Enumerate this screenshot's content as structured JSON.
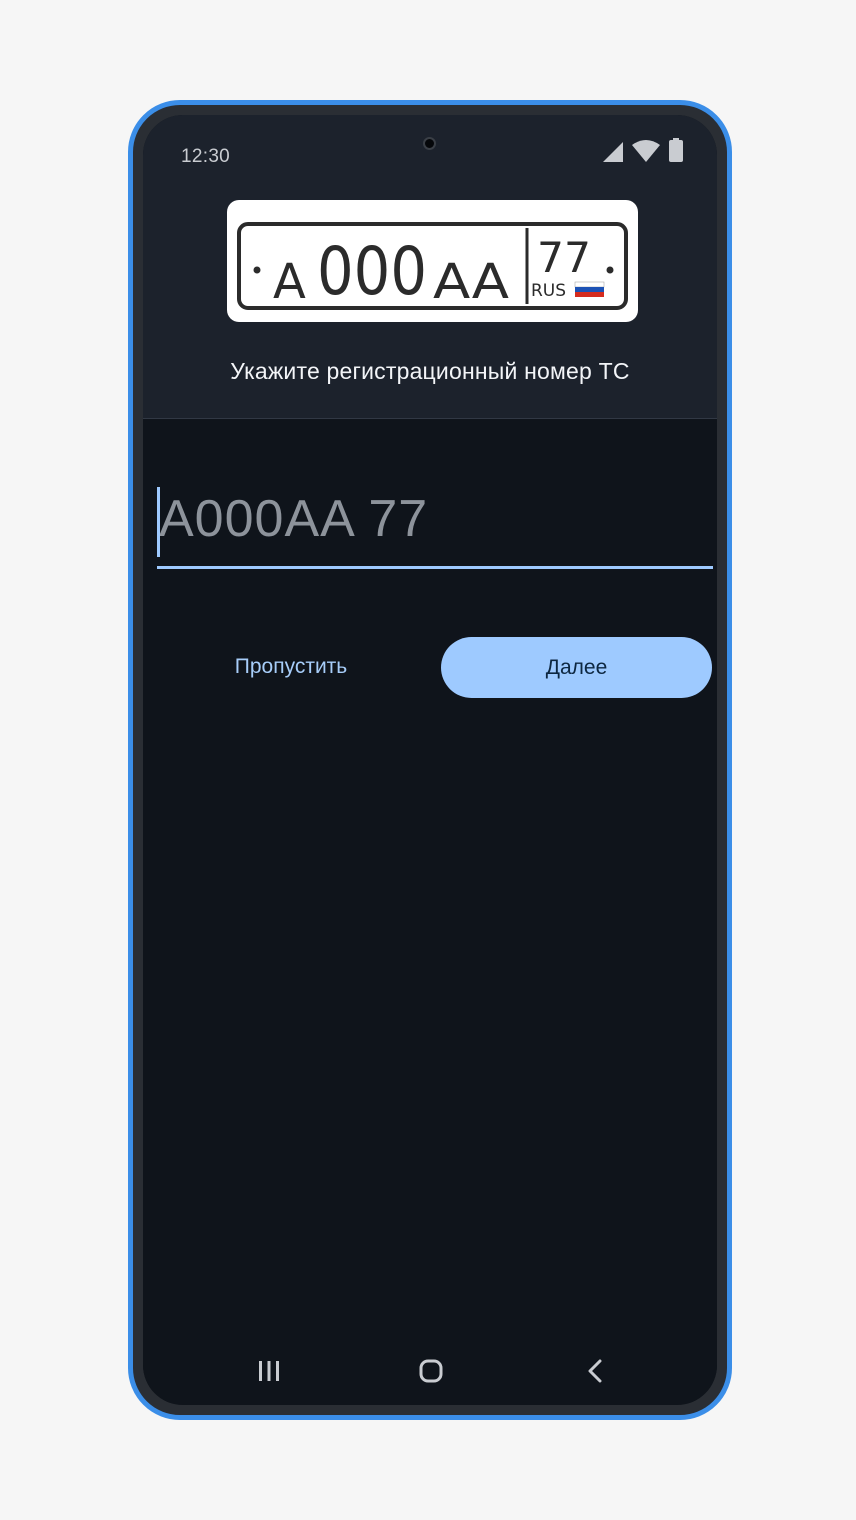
{
  "status_bar": {
    "time": "12:30",
    "icons": [
      "cellular-signal-icon",
      "wifi-icon",
      "battery-icon"
    ]
  },
  "header": {
    "plate_image": {
      "letter_left": "A",
      "digits": "000",
      "letters_right": "AA",
      "region": "77",
      "country": "RUS",
      "flag_colors": [
        "#ffffff",
        "#1c52b5",
        "#d52b1e"
      ]
    },
    "prompt": "Укажите регистрационный номер ТС"
  },
  "form": {
    "plate_input": {
      "value": "",
      "placeholder": "A000AA 77"
    },
    "skip_label": "Пропустить",
    "next_label": "Далее"
  },
  "nav_bar": {
    "buttons": [
      "recent-apps-icon",
      "home-icon",
      "back-icon"
    ]
  },
  "colors": {
    "accent": "#9ecaff",
    "frame": "#3b8ee8",
    "screen_bg": "#0f141b",
    "header_bg": "#1c222c"
  }
}
